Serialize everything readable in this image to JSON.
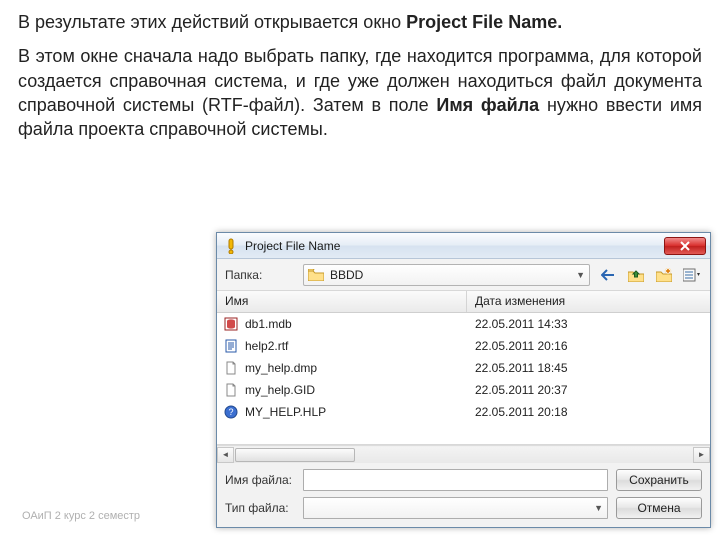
{
  "slide": {
    "para1_a": "В результате этих действий открывается окно ",
    "para1_b": "Project File Name.",
    "para2_a": "В этом окне сначала надо выбрать папку, где находится программа, для которой создается справочная система, и где уже должен находиться файл документа справочной системы (RTF-файл). Затем в поле ",
    "para2_b": "Имя файла",
    "para2_c": " нужно ввести имя файла проекта справочной системы.",
    "footer": "ОАиП 2 курс 2 семестр"
  },
  "dialog": {
    "title": "Project File Name",
    "folder_label": "Папка:",
    "folder_value": "BBDD",
    "nav_back_tip": "Назад",
    "columns": {
      "name": "Имя",
      "date": "Дата изменения"
    },
    "files": [
      {
        "icon": "db",
        "name": "db1.mdb",
        "date": "22.05.2011 14:33"
      },
      {
        "icon": "doc",
        "name": "help2.rtf",
        "date": "22.05.2011 20:16"
      },
      {
        "icon": "file",
        "name": "my_help.dmp",
        "date": "22.05.2011 18:45"
      },
      {
        "icon": "file",
        "name": "my_help.GID",
        "date": "22.05.2011 20:37"
      },
      {
        "icon": "hlp",
        "name": "MY_HELP.HLP",
        "date": "22.05.2011 20:18"
      }
    ],
    "filename_label": "Имя файла:",
    "filename_value": "",
    "filetype_label": "Тип файла:",
    "filetype_value": "",
    "save_btn": "Сохранить",
    "cancel_btn": "Отмена"
  }
}
